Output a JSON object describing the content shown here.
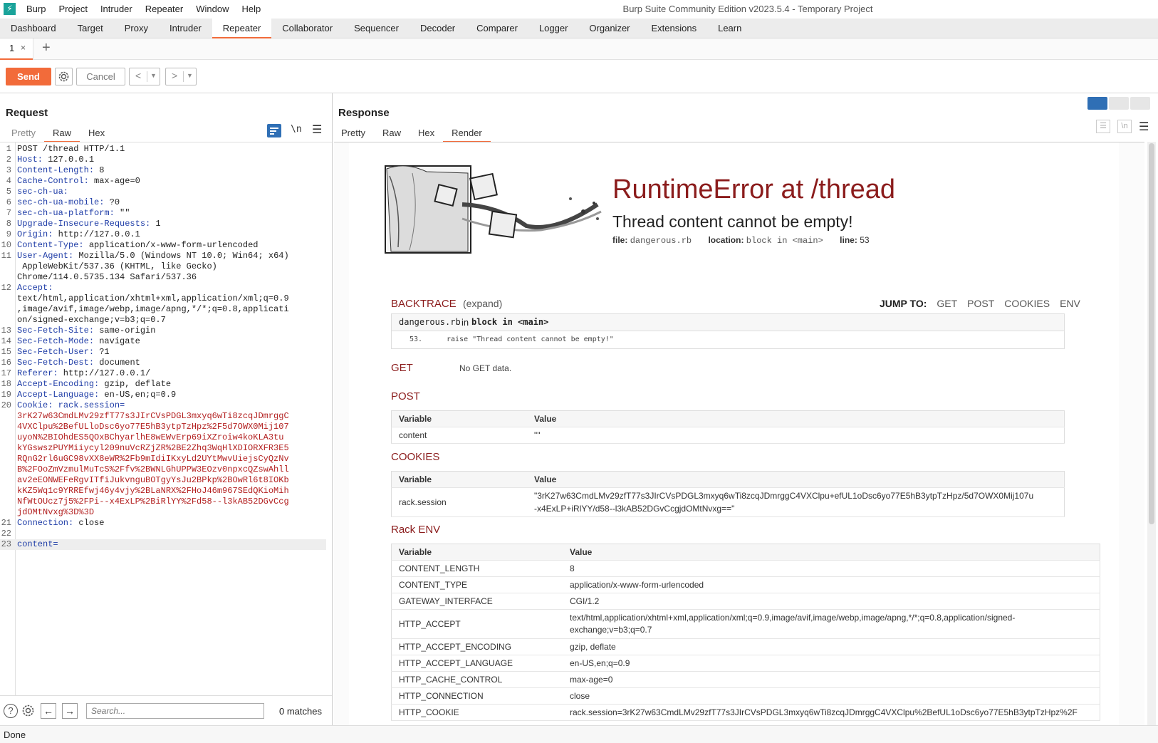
{
  "app": {
    "window_title": "Burp Suite Community Edition v2023.5.4 - Temporary Project",
    "menu": [
      "Burp",
      "Project",
      "Intruder",
      "Repeater",
      "Window",
      "Help"
    ]
  },
  "main_tabs": [
    "Dashboard",
    "Target",
    "Proxy",
    "Intruder",
    "Repeater",
    "Collaborator",
    "Sequencer",
    "Decoder",
    "Comparer",
    "Logger",
    "Organizer",
    "Extensions",
    "Learn"
  ],
  "active_main_tab": "Repeater",
  "repeater_tabs": [
    {
      "label": "1",
      "close": "×"
    }
  ],
  "add_tab": "+",
  "toolbar": {
    "send_label": "Send",
    "cancel_label": "Cancel",
    "back": "<",
    "forward": ">",
    "dropdown": "▼"
  },
  "request": {
    "title": "Request",
    "tabs": [
      "Pretty",
      "Raw",
      "Hex"
    ],
    "active_tab": "Raw",
    "newline_toggle": "\\n",
    "lines": [
      {
        "n": "1",
        "key": "",
        "val": "POST /thread HTTP/1.1"
      },
      {
        "n": "2",
        "key": "Host:",
        "val": " 127.0.0.1"
      },
      {
        "n": "3",
        "key": "Content-Length:",
        "val": " 8"
      },
      {
        "n": "4",
        "key": "Cache-Control:",
        "val": " max-age=0"
      },
      {
        "n": "5",
        "key": "sec-ch-ua:",
        "val": ""
      },
      {
        "n": "6",
        "key": "sec-ch-ua-mobile:",
        "val": " ?0"
      },
      {
        "n": "7",
        "key": "sec-ch-ua-platform:",
        "val": " \"\""
      },
      {
        "n": "8",
        "key": "Upgrade-Insecure-Requests:",
        "val": " 1"
      },
      {
        "n": "9",
        "key": "Origin:",
        "val": " http://127.0.0.1"
      },
      {
        "n": "10",
        "key": "Content-Type:",
        "val": " application/x-www-form-urlencoded"
      },
      {
        "n": "11",
        "key": "User-Agent:",
        "val": " Mozilla/5.0 (Windows NT 10.0; Win64; x64)"
      },
      {
        "n": "",
        "key": "",
        "val": " AppleWebKit/537.36 (KHTML, like Gecko)"
      },
      {
        "n": "",
        "key": "",
        "val": "Chrome/114.0.5735.134 Safari/537.36"
      },
      {
        "n": "12",
        "key": "Accept:",
        "val": ""
      },
      {
        "n": "",
        "key": "",
        "val": "text/html,application/xhtml+xml,application/xml;q=0.9"
      },
      {
        "n": "",
        "key": "",
        "val": ",image/avif,image/webp,image/apng,*/*;q=0.8,applicati"
      },
      {
        "n": "",
        "key": "",
        "val": "on/signed-exchange;v=b3;q=0.7"
      },
      {
        "n": "13",
        "key": "Sec-Fetch-Site:",
        "val": " same-origin"
      },
      {
        "n": "14",
        "key": "Sec-Fetch-Mode:",
        "val": " navigate"
      },
      {
        "n": "15",
        "key": "Sec-Fetch-User:",
        "val": " ?1"
      },
      {
        "n": "16",
        "key": "Sec-Fetch-Dest:",
        "val": " document"
      },
      {
        "n": "17",
        "key": "Referer:",
        "val": " http://127.0.0.1/"
      },
      {
        "n": "18",
        "key": "Accept-Encoding:",
        "val": " gzip, deflate"
      },
      {
        "n": "19",
        "key": "Accept-Language:",
        "val": " en-US,en;q=0.9"
      },
      {
        "n": "20",
        "key": "Cookie:",
        "val": " ",
        "cookie_name": "rack.session="
      },
      {
        "n": "",
        "key": "",
        "cookie": "3rK27w63CmdLMv29zfT77s3JIrCVsPDGL3mxyq6wTi8zcqJDmrggC"
      },
      {
        "n": "",
        "key": "",
        "cookie": "4VXClpu%2BefULloDsc6yo77E5hB3ytpTzHpz%2F5d7OWX0Mij107"
      },
      {
        "n": "",
        "key": "",
        "cookie": "uyoN%2BIOhdES5QOxBChyarlhE8wEWvErp69iXZroiw4koKLA3tu"
      },
      {
        "n": "",
        "key": "",
        "cookie": "kYGswszPUYMiiycyl209nuVcRZjZR%2BE2Zhq3WqHlXDIORXFR3E5"
      },
      {
        "n": "",
        "key": "",
        "cookie": "RQnG2rl6uGC98vXX8eWR%2Fb9mIdiIKxyLd2UYtMwvUiejsCyQzNv"
      },
      {
        "n": "",
        "key": "",
        "cookie": "B%2FOoZmVzmulMuTcS%2Ffv%2BWNLGhUPPW3EOzv0npxcQZswAhll"
      },
      {
        "n": "",
        "key": "",
        "cookie": "av2eEONWEFeRgvITfiJukvnguBOTgyYsJu2BPkp%2BOwRl6t8IOKb"
      },
      {
        "n": "",
        "key": "",
        "cookie": "kKZ5Wq1c9YRREfwj46y4vjy%2BLaNRX%2FHoJ46m967SEdQKioMih"
      },
      {
        "n": "",
        "key": "",
        "cookie": "NfWtOUcz7j5%2FPi--x4ExLP%2BiRlYY%2Fd58--l3kAB52DGvCcg"
      },
      {
        "n": "",
        "key": "",
        "cookie": "jdOMtNvxg%3D%3D"
      },
      {
        "n": "21",
        "key": "Connection:",
        "val": " close"
      },
      {
        "n": "22",
        "key": "",
        "val": ""
      },
      {
        "n": "23",
        "key": "content=",
        "val": "",
        "current": true
      }
    ],
    "search_placeholder": "Search...",
    "matches": "0 matches",
    "help": "?"
  },
  "response": {
    "title": "Response",
    "tabs": [
      "Pretty",
      "Raw",
      "Hex",
      "Render"
    ],
    "active_tab": "Render",
    "newline_toggle": "\\n",
    "render": {
      "error_title": "RuntimeError at /thread",
      "error_message": "Thread content cannot be empty!",
      "file_label": "file:",
      "file_value": "dangerous.rb",
      "location_label": "location:",
      "location_value": "block in <main>",
      "line_label": "line:",
      "line_value": "53",
      "backtrace_label": "BACKTRACE",
      "expand_label": "(expand)",
      "jump_label": "JUMP TO:",
      "jump_links": [
        "GET",
        "POST",
        "COOKIES",
        "ENV"
      ],
      "bt_file": "dangerous.rb",
      "bt_in": "in",
      "bt_frame": "block in <main>",
      "bt_line_no": "53.",
      "bt_code": "raise \"Thread content cannot be empty!\"",
      "get_label": "GET",
      "get_text": "No GET data.",
      "post_label": "POST",
      "cookies_label": "COOKIES",
      "env_label": "Rack ENV",
      "col_variable": "Variable",
      "col_value": "Value",
      "post_rows": [
        {
          "k": "content",
          "v": "\"\""
        }
      ],
      "cookie_rows": [
        {
          "k": "rack.session",
          "v": "\"3rK27w63CmdLMv29zfT77s3JIrCVsPDGL3mxyq6wTi8zcqJDmrggC4VXClpu+efUL1oDsc6yo77E5hB3ytpTzHpz/5d7OWX0Mij107u",
          "v2": "-x4ExLP+iRlYY/d58--l3kAB52DGvCcgjdOMtNvxg==\""
        }
      ],
      "env_rows": [
        {
          "k": "CONTENT_LENGTH",
          "v": "8"
        },
        {
          "k": "CONTENT_TYPE",
          "v": "application/x-www-form-urlencoded"
        },
        {
          "k": "GATEWAY_INTERFACE",
          "v": "CGI/1.2"
        },
        {
          "k": "HTTP_ACCEPT",
          "v": "text/html,application/xhtml+xml,application/xml;q=0.9,image/avif,image/webp,image/apng,*/*;q=0.8,application/signed-",
          "v2": "exchange;v=b3;q=0.7"
        },
        {
          "k": "HTTP_ACCEPT_ENCODING",
          "v": "gzip, deflate"
        },
        {
          "k": "HTTP_ACCEPT_LANGUAGE",
          "v": "en-US,en;q=0.9"
        },
        {
          "k": "HTTP_CACHE_CONTROL",
          "v": "max-age=0"
        },
        {
          "k": "HTTP_CONNECTION",
          "v": "close"
        },
        {
          "k": "HTTP_COOKIE",
          "v": "rack.session=3rK27w63CmdLMv29zfT77s3JIrCVsPDGL3mxyq6wTi8zcqJDmrggC4VXClpu%2BefUL1oDsc6yo77E5hB3ytpTzHpz%2F"
        }
      ]
    }
  },
  "status": {
    "text": "Done"
  },
  "colors": {
    "accent": "#f26b3a",
    "error_red": "#8b1c1c",
    "header_blue": "#1f3da7",
    "cookie_red": "#b32020"
  }
}
